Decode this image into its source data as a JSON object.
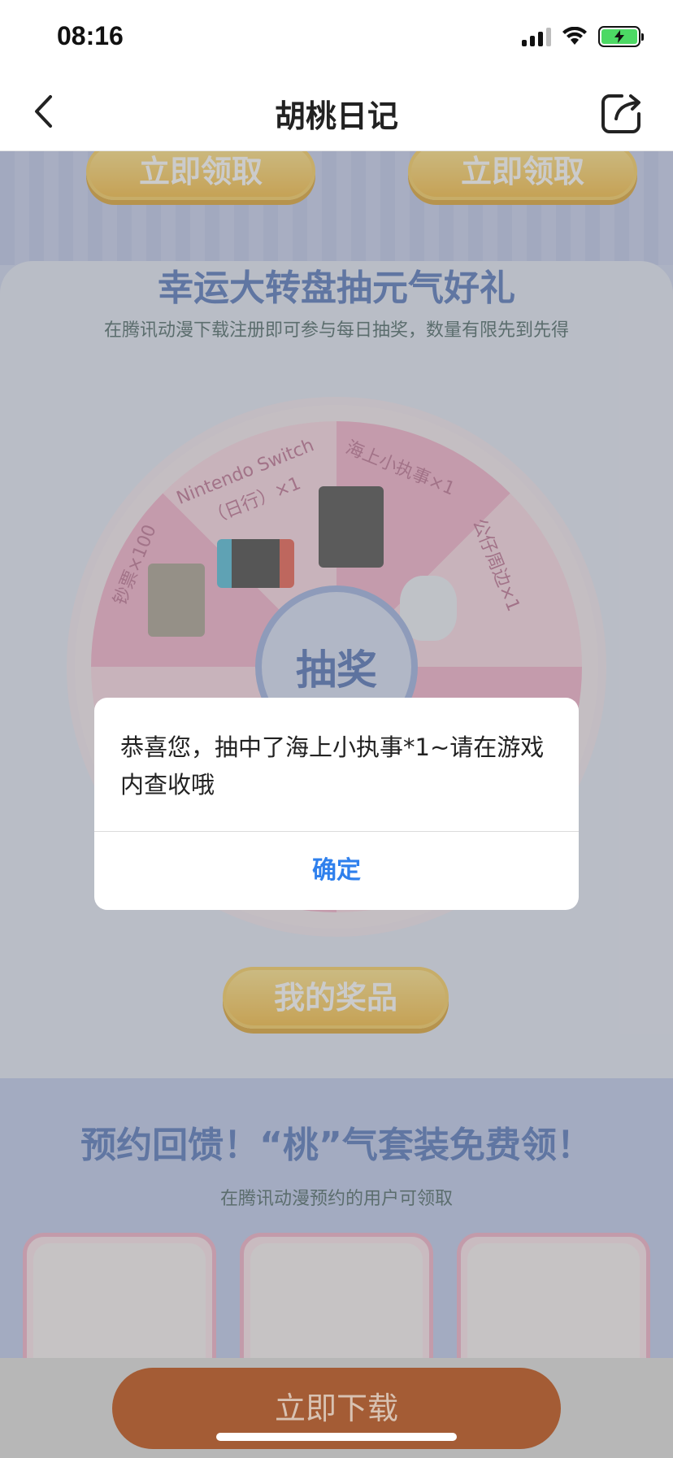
{
  "status_bar": {
    "time": "08:16"
  },
  "nav": {
    "title": "胡桃日记"
  },
  "page": {
    "top_claim_buttons": [
      "立即领取",
      "立即领取"
    ],
    "lottery_title": "幸运大转盘抽元气好礼",
    "lottery_subtitle": "在腾讯动漫下载注册即可参与每日抽奖，数量有限先到先得",
    "wheel_center": "抽奖",
    "wheel_labels": [
      "Nintendo Switch",
      "（日行）×1",
      "海上小执事×1",
      "公仔周边×1",
      "钞票×100"
    ],
    "my_prizes_button": "我的奖品",
    "reserve_title": "预约回馈！“桃”气套装免费领！",
    "reserve_subtitle": "在腾讯动漫预约的用户可领取"
  },
  "dialog": {
    "message": "恭喜您，抽中了海上小执事*1~请在游戏内查收哦",
    "confirm": "确定"
  },
  "download": {
    "label": "立即下载"
  }
}
